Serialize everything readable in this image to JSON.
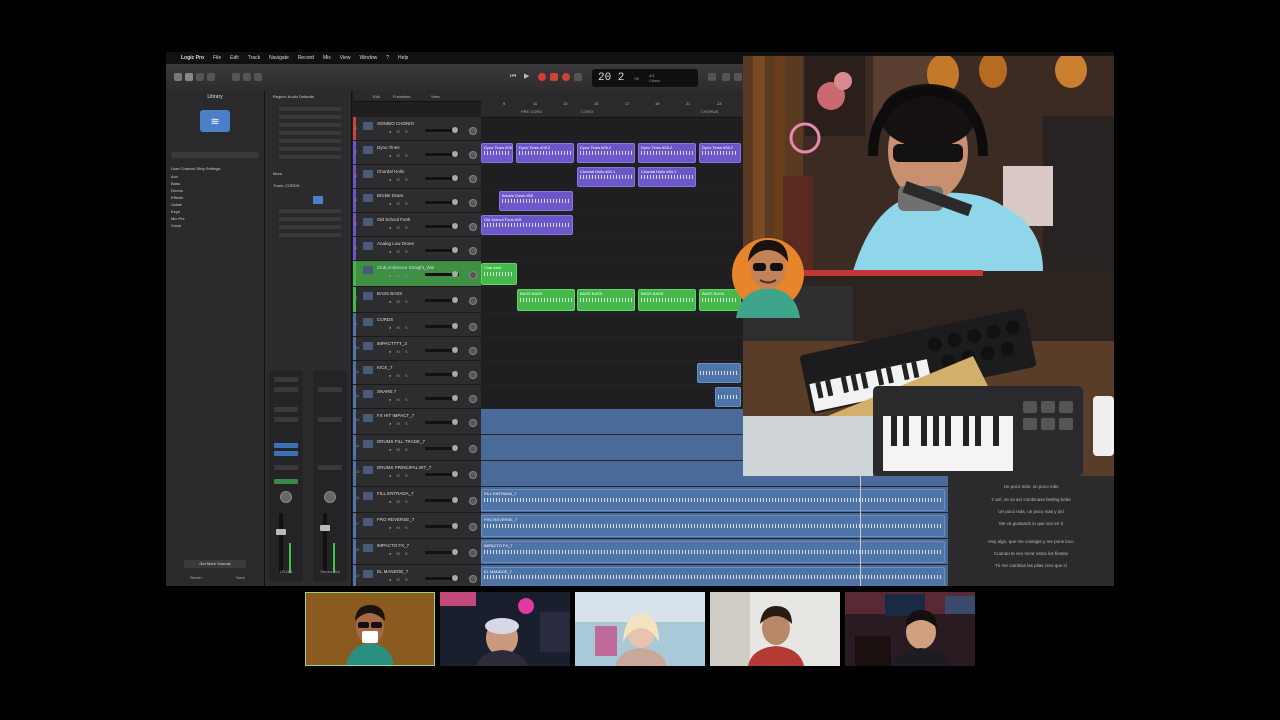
{
  "menubar": {
    "apple": "",
    "items": [
      "Logic Pro",
      "File",
      "Edit",
      "Track",
      "Navigate",
      "Record",
      "Mix",
      "View",
      "Window",
      "?",
      "Help"
    ]
  },
  "transport": {
    "bar_position": "20  2",
    "tempo": "96",
    "signature": "4/4",
    "key": "C#min"
  },
  "library": {
    "title": "Library",
    "setting": "User Channel Strip Settings",
    "items": [
      "Aux",
      "Bass",
      "Drums",
      "Effects",
      "Guitar",
      "Keys",
      "Mic Pre",
      "Vocal"
    ],
    "get_more": "Get More Sounds",
    "revert": "Revert",
    "save": "Save"
  },
  "inspector": {
    "header": "Region: Audio Defaults",
    "more": "More",
    "track_label": "Track: CORDS",
    "strip_a": "LR-ON",
    "strip_b": "Stereo Out"
  },
  "arrange": {
    "edit": "Edit",
    "functions": "Functions",
    "view": "View",
    "ruler_ticks": [
      "9",
      "11",
      "13",
      "15",
      "17",
      "19",
      "21",
      "23"
    ],
    "markers": [
      "PRE CORO",
      "CORO",
      "CHORUS"
    ],
    "tracks": [
      {
        "num": "1",
        "name": "SONIDO CHONIO",
        "color": "#c94444"
      },
      {
        "num": "2",
        "name": "Dyno Tines",
        "color": "#6b57c9"
      },
      {
        "num": "3",
        "name": "Chordal Hollo",
        "color": "#6b57c9"
      },
      {
        "num": "4",
        "name": "Brickle Down",
        "color": "#6b57c9"
      },
      {
        "num": "5",
        "name": "Old School Funk",
        "color": "#6b57c9"
      },
      {
        "num": "6",
        "name": "Analog Low Drone",
        "color": "#6b57c9"
      },
      {
        "num": "7",
        "name": "Club Ambience Straight_Wal",
        "color": "#44b84a"
      },
      {
        "num": "8",
        "name": "BASS BASS",
        "color": "#44b84a"
      },
      {
        "num": "9",
        "name": "CORDS",
        "color": "#4f74a8"
      },
      {
        "num": "10",
        "name": "IMPACTTTT_3",
        "color": "#4f74a8"
      },
      {
        "num": "11",
        "name": "KICK_7",
        "color": "#4f74a8"
      },
      {
        "num": "12",
        "name": "SNARE 7",
        "color": "#4f74a8"
      },
      {
        "num": "13",
        "name": "FX HIT IMPACT_7",
        "color": "#4f74a8"
      },
      {
        "num": "14",
        "name": "DRUMS FILL TRADE_7",
        "color": "#4f74a8"
      },
      {
        "num": "15",
        "name": "DRUMS PRINCIPAL BIT_7",
        "color": "#4f74a8"
      },
      {
        "num": "16",
        "name": "FILL ENTRADA_7",
        "color": "#4f74a8"
      },
      {
        "num": "17",
        "name": "FRO REVERSE_7",
        "color": "#4f74a8"
      },
      {
        "num": "18",
        "name": "IMPACTO FX_7",
        "color": "#4f74a8"
      },
      {
        "num": "19",
        "name": "EL MANDOE_7",
        "color": "#4f74a8"
      }
    ],
    "regions": {
      "dyno": "Dyno Tines #05.2",
      "chordal": "Chordal Hollo #04.1",
      "brickle": "Brickle Down #05",
      "oldschool": "Old School Funk #05",
      "club": "Club Amb",
      "bass": "BASS BASS",
      "fill": "FILL ENTRADA_7",
      "fro": "FRO REVERSE_7",
      "impacto": "IMPACTO FX_7",
      "mandoe": "EL MANDOE_7"
    },
    "colors": {
      "purple": "#6b57c9",
      "green": "#44b84a",
      "blue": "#4f74a8",
      "red": "#c94444"
    }
  },
  "lyrics": [
    "Un poco más, un poco más",
    "Y así, se va así combinase feeling bebe",
    "Un poco más, un poco más y así",
    "Me va gustando lo que veo en ti",
    "Hoy algo, que me contagie y me pone loco",
    "Cuando te veo mirar estos los fiestas",
    "Tú me cambias las pilas creo que sí"
  ],
  "participants": [
    "participant-1",
    "participant-2",
    "participant-3",
    "participant-4",
    "participant-5"
  ]
}
